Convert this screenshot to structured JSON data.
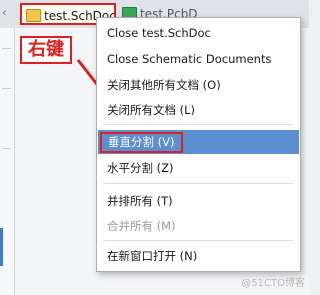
{
  "tabs": {
    "active_label": "test.SchDoc",
    "inactive_label": "test.PcbDoc"
  },
  "annotation": {
    "label": "右键",
    "color": "#e02020"
  },
  "menu": {
    "items": [
      {
        "label": "Close test.SchDoc",
        "enabled": true
      },
      {
        "label": "Close Schematic Documents",
        "enabled": true
      },
      {
        "label": "关闭其他所有文档 (O)",
        "enabled": true
      },
      {
        "label": "关闭所有文档 (L)",
        "enabled": true
      },
      {
        "label": "垂直分割 (V)",
        "enabled": true,
        "highlighted": true
      },
      {
        "label": "水平分割 (Z)",
        "enabled": true
      },
      {
        "label": "并排所有 (T)",
        "enabled": true
      },
      {
        "label": "合并所有 (M)",
        "enabled": false
      },
      {
        "label": "在新窗口打开 (N)",
        "enabled": true
      }
    ],
    "highlight_color": "#5b8fd1"
  },
  "watermark": "@51CTO博客"
}
